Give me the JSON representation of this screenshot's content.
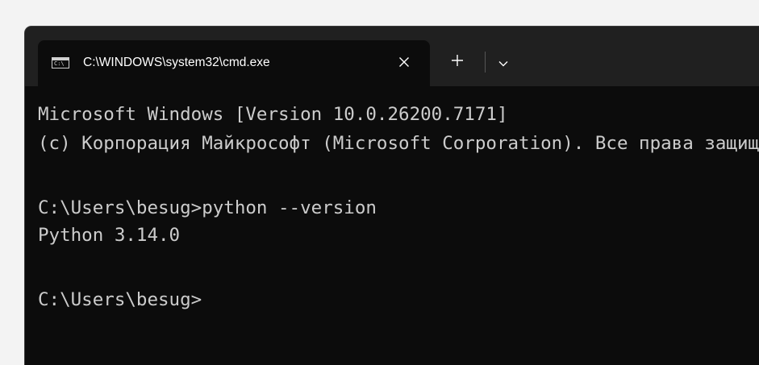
{
  "tab": {
    "icon_text": "C:\\",
    "title": "C:\\WINDOWS\\system32\\cmd.exe",
    "close_glyph": "close-icon"
  },
  "tabbar": {
    "new_tab_glyph": "plus-icon",
    "dropdown_glyph": "chevron-down-icon"
  },
  "terminal": {
    "lines": [
      "Microsoft Windows [Version 10.0.26200.7171]",
      "(c) Корпорация Майкрософт (Microsoft Corporation). Все права защищены.",
      "C:\\Users\\besug>python --version",
      "Python 3.14.0",
      "C:\\Users\\besug>"
    ]
  },
  "colors": {
    "page_background": "#f3f3f3",
    "titlebar": "#202020",
    "terminal_background": "#0c0c0c",
    "terminal_text": "#cccccc",
    "tab_text": "#ffffff"
  }
}
